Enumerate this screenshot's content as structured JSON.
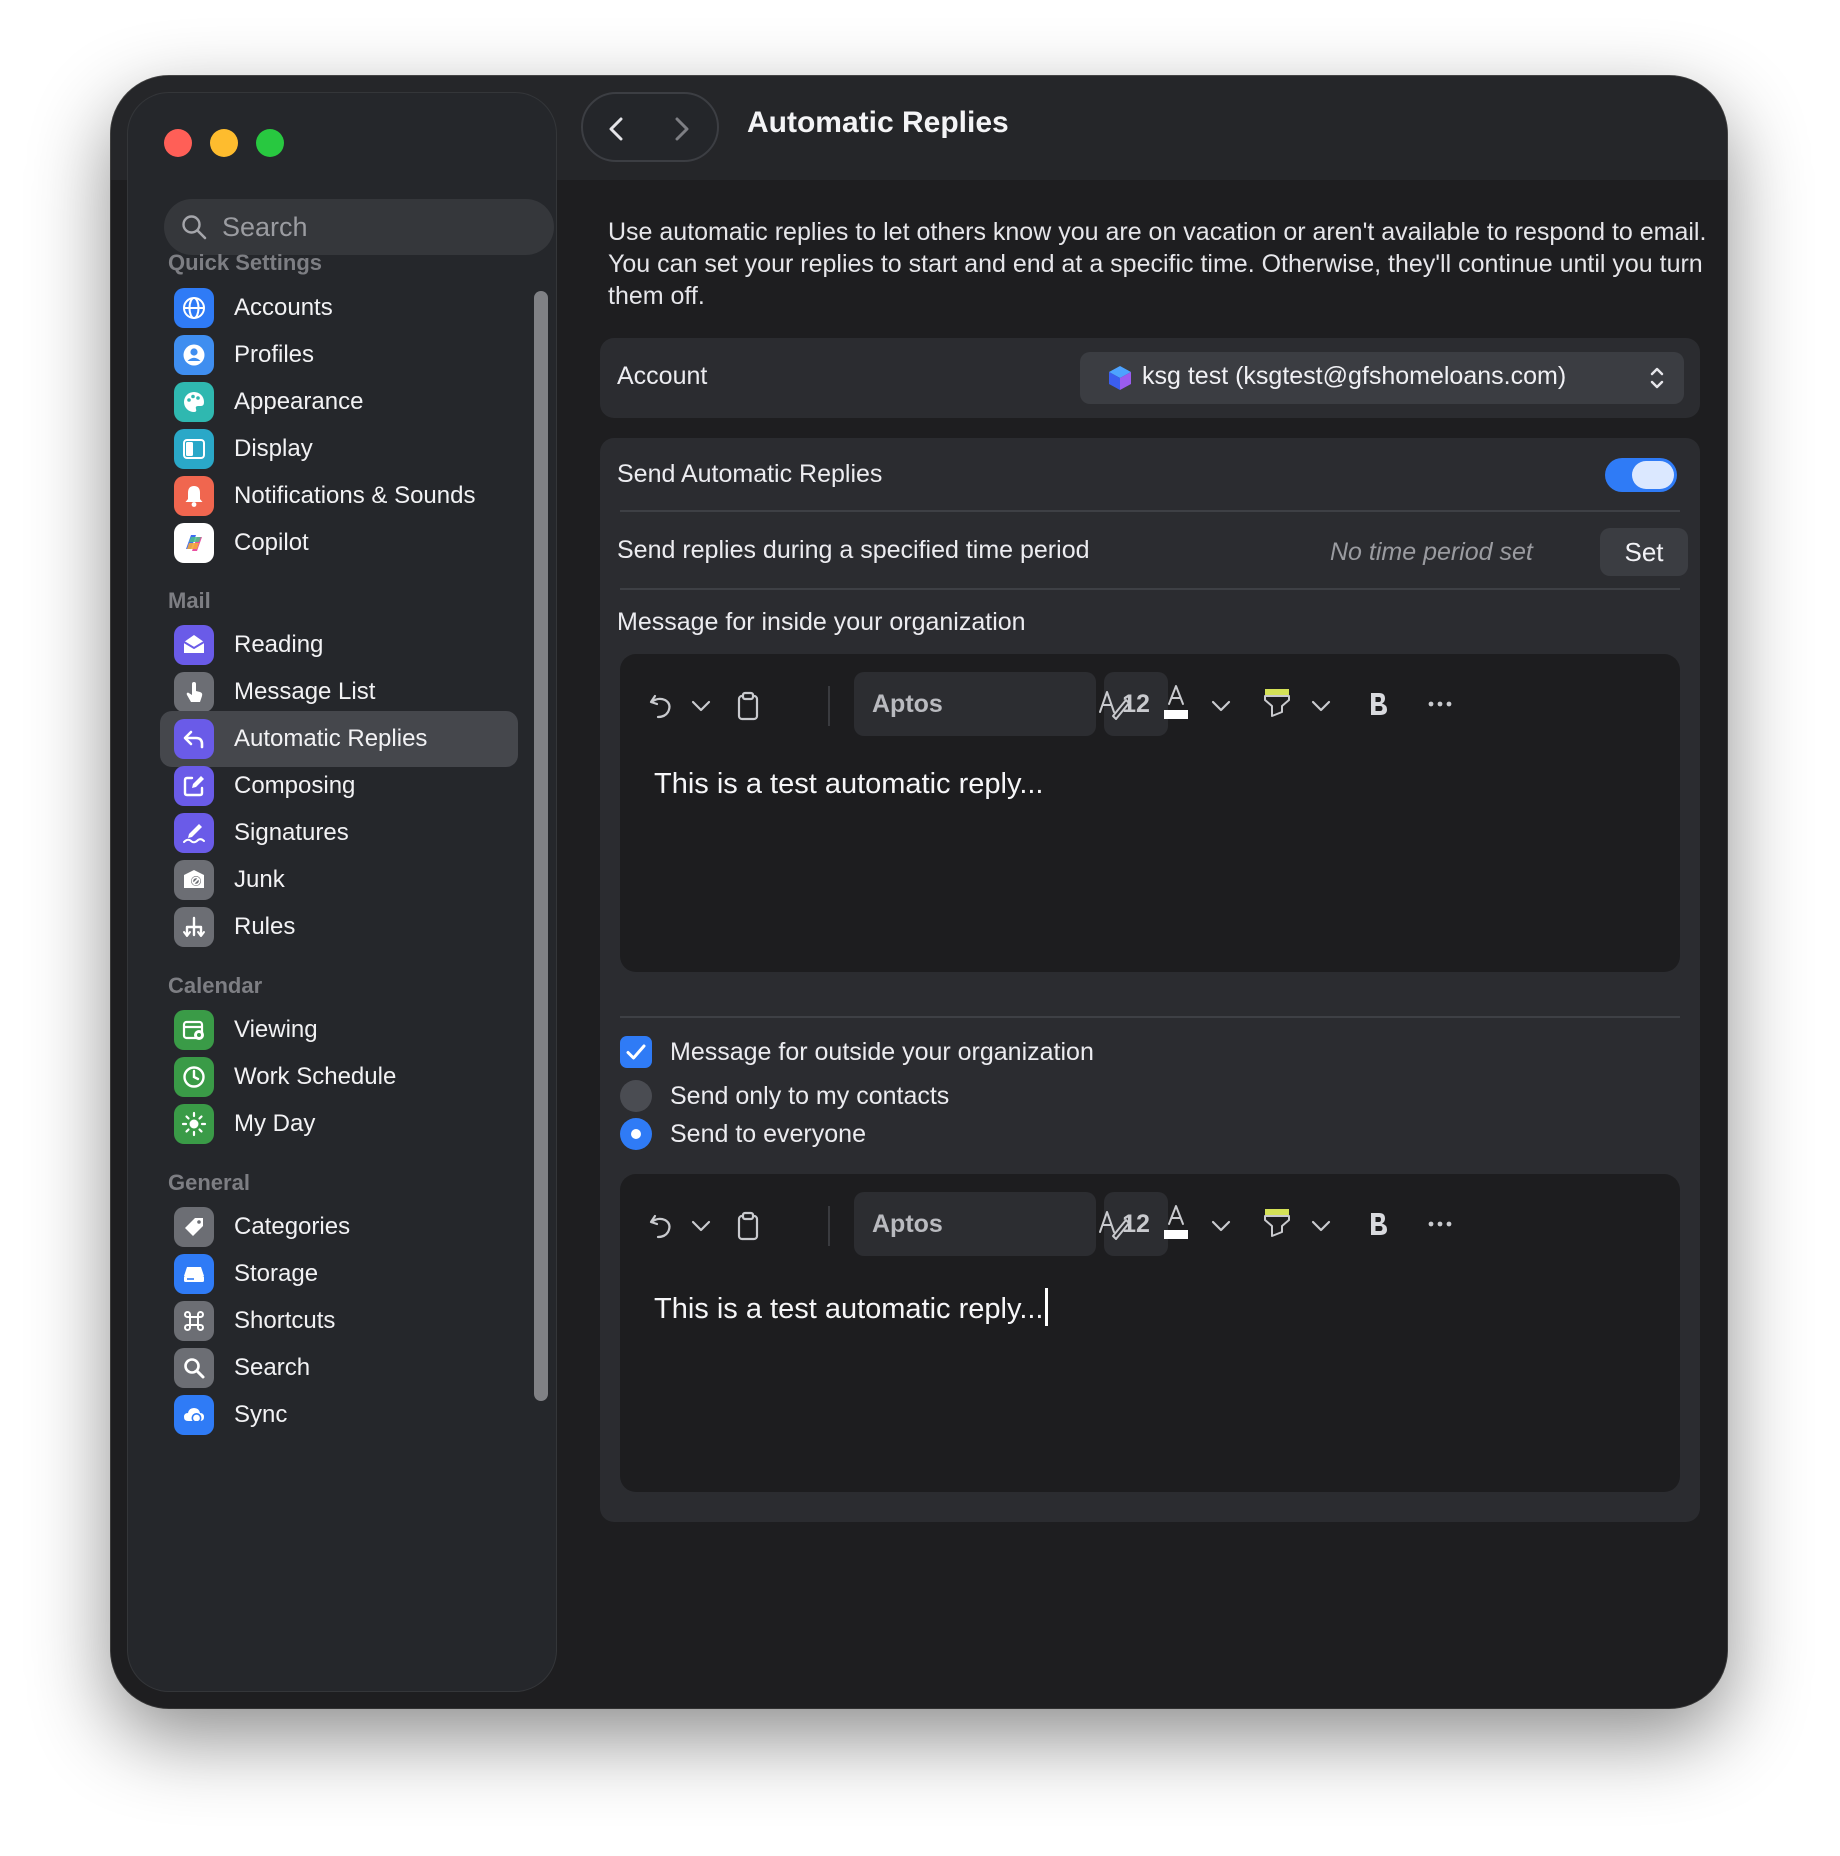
{
  "window": {
    "title": "Automatic Replies"
  },
  "sidebar": {
    "search_placeholder": "Search",
    "sections": {
      "quick": "Quick Settings",
      "mail": "Mail",
      "calendar": "Calendar",
      "general": "General"
    },
    "quick_items": [
      {
        "label": "Accounts",
        "icon": "globe-icon"
      },
      {
        "label": "Profiles",
        "icon": "profile-icon"
      },
      {
        "label": "Appearance",
        "icon": "palette-icon"
      },
      {
        "label": "Display",
        "icon": "display-icon"
      },
      {
        "label": "Notifications & Sounds",
        "icon": "bell-icon"
      },
      {
        "label": "Copilot",
        "icon": "copilot-icon"
      }
    ],
    "mail_items": [
      {
        "label": "Reading",
        "icon": "envelope-icon"
      },
      {
        "label": "Message List",
        "icon": "hand-icon"
      },
      {
        "label": "Automatic Replies",
        "icon": "reply-icon",
        "selected": true
      },
      {
        "label": "Composing",
        "icon": "compose-icon"
      },
      {
        "label": "Signatures",
        "icon": "signature-icon"
      },
      {
        "label": "Junk",
        "icon": "junk-icon"
      },
      {
        "label": "Rules",
        "icon": "rules-icon"
      }
    ],
    "calendar_items": [
      {
        "label": "Viewing",
        "icon": "calendar-gear-icon"
      },
      {
        "label": "Work Schedule",
        "icon": "clock-icon"
      },
      {
        "label": "My Day",
        "icon": "sun-icon"
      }
    ],
    "general_items": [
      {
        "label": "Categories",
        "icon": "tag-icon"
      },
      {
        "label": "Storage",
        "icon": "storage-icon"
      },
      {
        "label": "Shortcuts",
        "icon": "command-icon"
      },
      {
        "label": "Search",
        "icon": "magnifier-icon"
      },
      {
        "label": "Sync",
        "icon": "sync-icon"
      }
    ]
  },
  "main": {
    "description": "Use automatic replies to let others know you are on vacation or aren't available to respond to email. You can set your replies to start and end at a specific time. Otherwise, they'll continue until you turn them off.",
    "account": {
      "label": "Account",
      "value": "ksg test (ksgtest@gfshomeloans.com)"
    },
    "send_auto_replies": {
      "label": "Send Automatic Replies",
      "enabled": true
    },
    "time_period": {
      "label": "Send replies during a specified time period",
      "status": "No time period set",
      "button": "Set"
    },
    "inside": {
      "label": "Message for inside your organization",
      "font": "Aptos",
      "size": "12",
      "text": "This is a test automatic reply..."
    },
    "outside": {
      "checkbox_label": "Message for outside your organization",
      "checked": true,
      "option_contacts": "Send only to my contacts",
      "option_everyone": "Send to everyone",
      "selected": "everyone",
      "font": "Aptos",
      "size": "12",
      "text": "This is a test automatic reply..."
    }
  },
  "colors": {
    "accent": "#2f7bf6",
    "window_bg": "#1e1e20",
    "sidebar_bg": "#25272b",
    "card_bg": "#2b2c30"
  }
}
